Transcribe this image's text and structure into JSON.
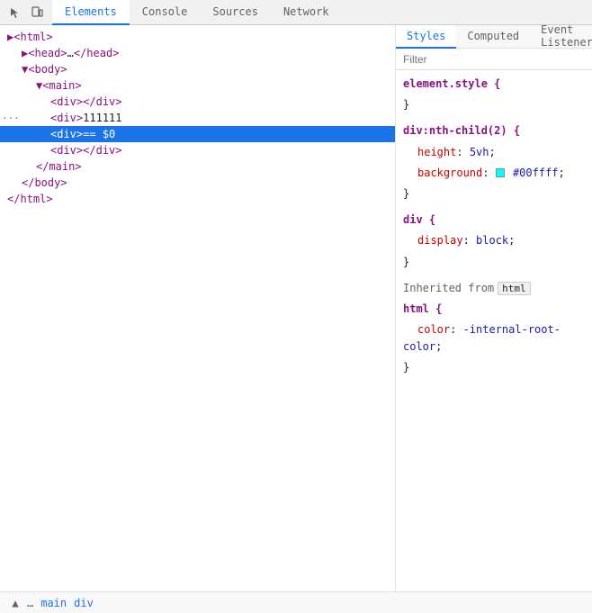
{
  "tabs": {
    "top": [
      "Elements",
      "Console",
      "Sources",
      "Network"
    ],
    "active_top": "Elements",
    "styles": [
      "Styles",
      "Computed",
      "Event Listeners"
    ],
    "active_styles": "Styles"
  },
  "filter": {
    "placeholder": "Filter",
    "value": ""
  },
  "dom": {
    "lines": [
      {
        "id": "html-open",
        "indent": 0,
        "content": "<html>"
      },
      {
        "id": "head",
        "indent": 1,
        "content": "<head>…</head>"
      },
      {
        "id": "body-open",
        "indent": 1,
        "content": "<body>"
      },
      {
        "id": "main-open",
        "indent": 2,
        "content": "<main>"
      },
      {
        "id": "div1",
        "indent": 3,
        "content": "<div></div>"
      },
      {
        "id": "div111111",
        "indent": 3,
        "content": "<div>111111"
      },
      {
        "id": "div-selected",
        "indent": 3,
        "content": "<div> == $0",
        "selected": true
      },
      {
        "id": "div-empty",
        "indent": 3,
        "content": "<div></div>"
      },
      {
        "id": "main-close",
        "indent": 2,
        "content": "</main>"
      },
      {
        "id": "body-close",
        "indent": 1,
        "content": "</body>"
      },
      {
        "id": "html-close",
        "indent": 0,
        "content": "</html>"
      }
    ]
  },
  "styles": {
    "rules": [
      {
        "selector": "element.style {",
        "properties": [],
        "close": "}"
      },
      {
        "selector": "div:nth-child(2) {",
        "properties": [
          {
            "prop": "height",
            "colon": ":",
            "value": " 5vh",
            "semi": ";"
          },
          {
            "prop": "background",
            "colon": ":",
            "value": " #00ffff",
            "semi": ";",
            "color_swatch": "#00ffff"
          }
        ],
        "close": "}"
      },
      {
        "selector": "div {",
        "properties": [
          {
            "prop": "display",
            "colon": ":",
            "value": " block",
            "semi": ";"
          }
        ],
        "close": "}"
      }
    ],
    "inherited": {
      "label": "Inherited from",
      "tag": "html",
      "rules": [
        {
          "selector": "html {",
          "properties": [
            {
              "prop": "color",
              "colon": ":",
              "value": " -internal-root-color",
              "semi": ";"
            }
          ],
          "close": "}"
        }
      ]
    }
  },
  "breadcrumb": {
    "dots": "…",
    "items": [
      "main",
      "div"
    ]
  },
  "icons": {
    "cursor": "↖",
    "device": "⬜",
    "chevron_down": "▾",
    "ellipsis": "···"
  }
}
